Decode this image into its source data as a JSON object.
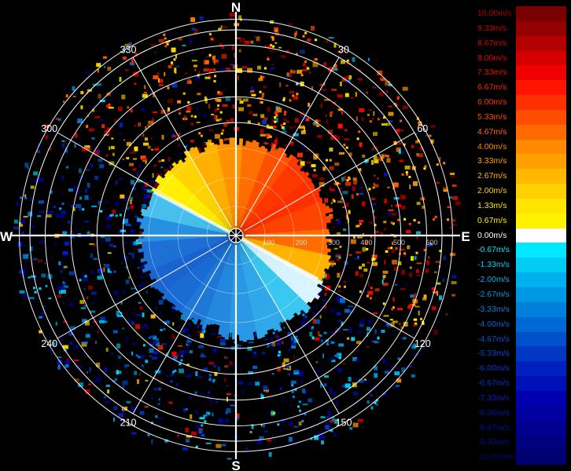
{
  "radar": {
    "cardinals": [
      {
        "label": "N",
        "bearing": 0
      },
      {
        "label": "E",
        "bearing": 90
      },
      {
        "label": "S",
        "bearing": 180
      },
      {
        "label": "W",
        "bearing": 270
      }
    ],
    "bearing_labels": [
      {
        "label": "30",
        "bearing": 30
      },
      {
        "label": "60",
        "bearing": 60
      },
      {
        "label": "120",
        "bearing": 120
      },
      {
        "label": "150",
        "bearing": 150
      },
      {
        "label": "210",
        "bearing": 210
      },
      {
        "label": "240",
        "bearing": 240
      },
      {
        "label": "300",
        "bearing": 300
      },
      {
        "label": "330",
        "bearing": 330
      }
    ],
    "range_labels": [
      "100",
      "200",
      "300",
      "400",
      "500",
      "600"
    ],
    "ring_count": 8,
    "inner_ring_count": 3,
    "colors": {
      "background": "#000000",
      "grid": "#ffffff",
      "label": "#ffffff",
      "zero_band": "#ffffff"
    }
  },
  "colorbar": {
    "entries": [
      {
        "label": "10.00m/s",
        "color": "#7a0000",
        "text_color": "#b00000"
      },
      {
        "label": "9.33m/s",
        "color": "#950000",
        "text_color": "#c40000"
      },
      {
        "label": "8.67m/s",
        "color": "#b40000",
        "text_color": "#d40000"
      },
      {
        "label": "8.00m/s",
        "color": "#d40000",
        "text_color": "#e00000"
      },
      {
        "label": "7.33m/s",
        "color": "#f00000",
        "text_color": "#f00000"
      },
      {
        "label": "6.67m/s",
        "color": "#ff1400",
        "text_color": "#ff2000"
      },
      {
        "label": "6.00m/s",
        "color": "#ff3000",
        "text_color": "#ff3000"
      },
      {
        "label": "5.33m/s",
        "color": "#ff4d00",
        "text_color": "#ff4a00"
      },
      {
        "label": "4.67m/s",
        "color": "#ff6a00",
        "text_color": "#ff6a00"
      },
      {
        "label": "4.00m/s",
        "color": "#ff8a00",
        "text_color": "#ff8a00"
      },
      {
        "label": "3.33m/s",
        "color": "#ffa000",
        "text_color": "#ffa000"
      },
      {
        "label": "2.67m/s",
        "color": "#ffb800",
        "text_color": "#ffb800"
      },
      {
        "label": "2.00m/s",
        "color": "#ffd000",
        "text_color": "#ffd000"
      },
      {
        "label": "1.33m/s",
        "color": "#ffe400",
        "text_color": "#ffe400"
      },
      {
        "label": "0.67m/s",
        "color": "#fff200",
        "text_color": "#fff200"
      },
      {
        "label": "0.00m/s",
        "color": "#ffffff",
        "text_color": "#ffffff"
      },
      {
        "label": "-0.67m/s",
        "color": "#00e8ff",
        "text_color": "#00e8ff"
      },
      {
        "label": "-1.33m/s",
        "color": "#00ccf4",
        "text_color": "#00ccf4"
      },
      {
        "label": "-2.00m/s",
        "color": "#00b0ee",
        "text_color": "#00b0ee"
      },
      {
        "label": "-2.67m/s",
        "color": "#0098e4",
        "text_color": "#0098e4"
      },
      {
        "label": "-3.33m/s",
        "color": "#0080dc",
        "text_color": "#0080dc"
      },
      {
        "label": "-4.00m/s",
        "color": "#0068d4",
        "text_color": "#0068d4"
      },
      {
        "label": "-4.67m/s",
        "color": "#0050cc",
        "text_color": "#0058d0"
      },
      {
        "label": "-5.33m/s",
        "color": "#0038c4",
        "text_color": "#0048d0"
      },
      {
        "label": "-6.00m/s",
        "color": "#0020c0",
        "text_color": "#0038d0"
      },
      {
        "label": "-6.67m/s",
        "color": "#0010b8",
        "text_color": "#0030c8"
      },
      {
        "label": "-7.33m/s",
        "color": "#0000b0",
        "text_color": "#0020c0"
      },
      {
        "label": "-8.00m/s",
        "color": "#0000a0",
        "text_color": "#0018b0"
      },
      {
        "label": "-8.67m/s",
        "color": "#000090",
        "text_color": "#0010a0"
      },
      {
        "label": "-9.33m/s",
        "color": "#000080",
        "text_color": "#000c90"
      },
      {
        "label": "-10.00m/s",
        "color": "#000070",
        "text_color": "#000880"
      }
    ]
  }
}
